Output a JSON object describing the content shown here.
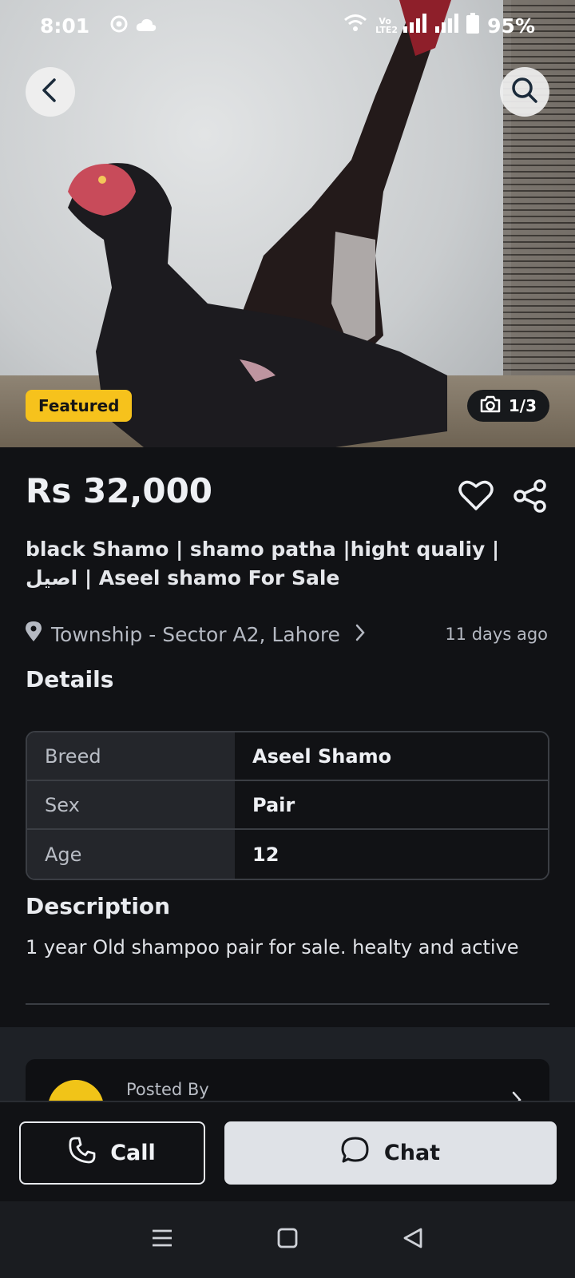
{
  "status_bar": {
    "time": "8:01",
    "network_label": "Vo LTE2",
    "battery": "95%",
    "icons": [
      "chrome-icon",
      "cloud-icon",
      "wifi-icon",
      "signal-icon",
      "battery-icon"
    ]
  },
  "gallery": {
    "badge": "Featured",
    "counter": "1/3"
  },
  "listing": {
    "price": "Rs 32,000",
    "title": "black Shamo | shamo patha |hight qualiy | اصیل | Aseel shamo For Sale",
    "location": "Township - Sector A2, Lahore",
    "posted_ago": "11 days ago"
  },
  "details": {
    "heading": "Details",
    "rows": [
      {
        "key": "Breed",
        "value": "Aseel Shamo"
      },
      {
        "key": "Sex",
        "value": "Pair"
      },
      {
        "key": "Age",
        "value": "12"
      }
    ]
  },
  "description": {
    "heading": "Description",
    "text": "1 year Old shampoo pair for sale. healty and active"
  },
  "seller": {
    "posted_by_label": "Posted By"
  },
  "actions": {
    "call_label": "Call",
    "chat_label": "Chat"
  },
  "colors": {
    "background": "#111215",
    "featured_badge": "#f6c21c",
    "chat_button": "#dfe2e7"
  }
}
